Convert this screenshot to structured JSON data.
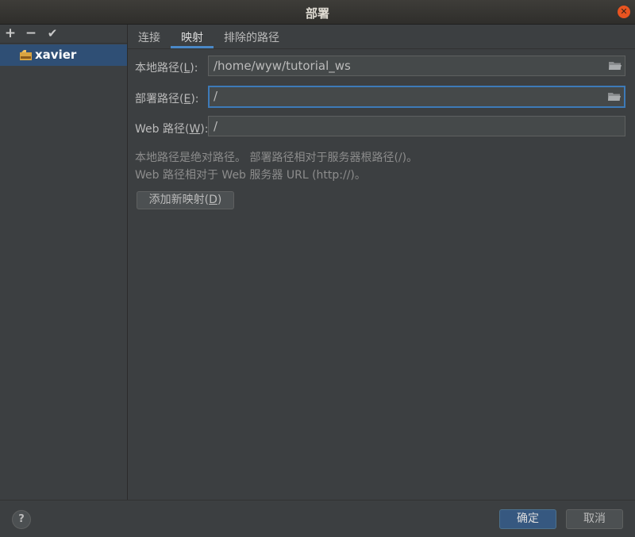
{
  "window": {
    "title": "部署",
    "close_icon": "close-icon"
  },
  "left_toolbar": {
    "add": "+",
    "remove": "−",
    "default": "✔"
  },
  "servers": [
    {
      "name": "xavier",
      "icon": "sftp-icon"
    }
  ],
  "tabs": [
    {
      "label": "连接",
      "active": false
    },
    {
      "label": "映射",
      "active": true
    },
    {
      "label": "排除的路径",
      "active": false
    }
  ],
  "mapping": {
    "local_path": {
      "label_prefix": "本地路径(",
      "mnemonic": "L",
      "label_suffix": "):",
      "value": "/home/wyw/tutorial_ws"
    },
    "deploy_path": {
      "label_prefix": "部署路径(",
      "mnemonic": "E",
      "label_suffix": "):",
      "value": "/"
    },
    "web_path": {
      "label_prefix": "Web 路径(",
      "mnemonic": "W",
      "label_suffix": "):",
      "value": "/"
    },
    "hint_line1": "本地路径是绝对路径。 部署路径相对于服务器根路径(/)。",
    "hint_line2": "Web 路径相对于 Web 服务器 URL (http://)。",
    "add_mapping": {
      "label_prefix": "添加新映射(",
      "mnemonic": "D",
      "label_suffix": ")"
    }
  },
  "footer": {
    "help": "?",
    "ok": "确定",
    "cancel": "取消"
  },
  "colors": {
    "accent": "#4a88c7",
    "selection": "#2f4f75",
    "background": "#3c3f41",
    "ok_button": "#365880"
  }
}
